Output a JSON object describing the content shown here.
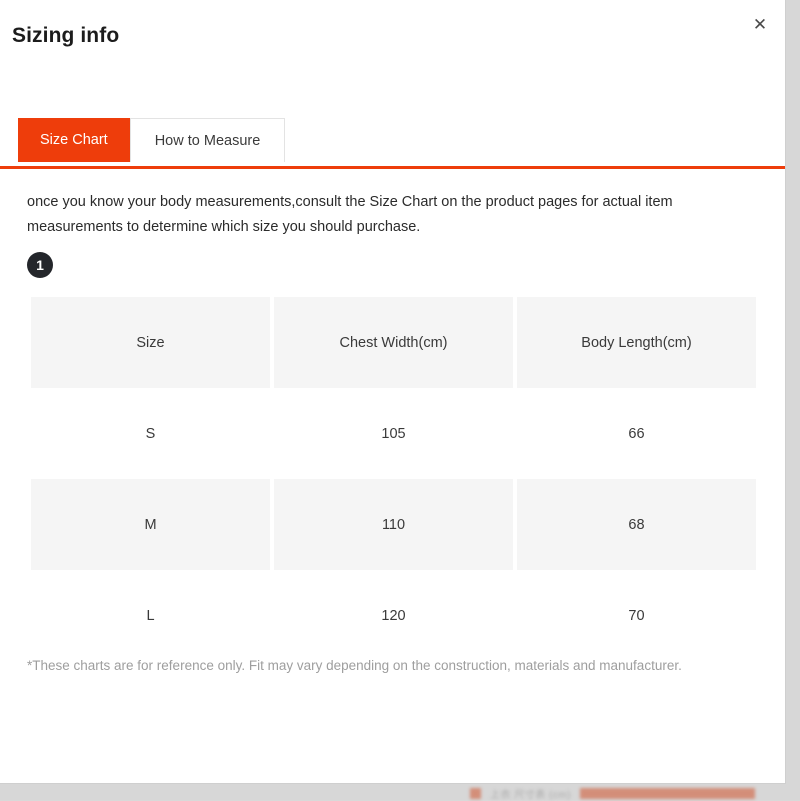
{
  "modal": {
    "title": "Sizing info",
    "close_icon": "close-icon",
    "close_label": "✕"
  },
  "tabs": [
    {
      "label": "Size Chart",
      "active": true
    },
    {
      "label": "How to Measure",
      "active": false
    }
  ],
  "description": "once you know your body measurements,consult the Size Chart on the product pages for actual item measurements to determine which size you should purchase.",
  "step_badge": "1",
  "table": {
    "headers": [
      "Size",
      "Chest Width(cm)",
      "Body Length(cm)"
    ],
    "rows": [
      [
        "S",
        "105",
        "66"
      ],
      [
        "M",
        "110",
        "68"
      ],
      [
        "L",
        "120",
        "70"
      ]
    ]
  },
  "footnote": "*These charts are for reference only. Fit may vary depending on the construction, materials and manufacturer.",
  "background_strip": {
    "text": "上衣 尺寸表 (cm)"
  },
  "colors": {
    "accent": "#ee3d0b",
    "header_bg": "#f5f5f5",
    "badge_bg": "#24262b",
    "footnote": "#9e9e9e"
  }
}
